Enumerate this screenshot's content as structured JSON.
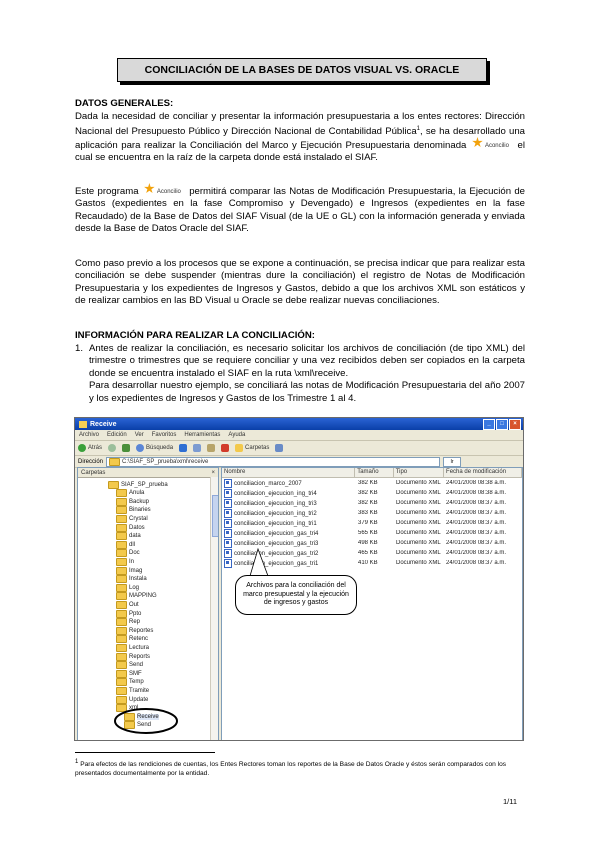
{
  "title": "CONCILIACIÓN DE LA BASES DE DATOS VISUAL VS. ORACLE",
  "section1": {
    "heading": "DATOS GENERALES:",
    "p1_a": "Dada la necesidad de conciliar y presentar la información presupuestaria a los entes rectores: Dirección Nacional del Presupuesto Público y Dirección Nacional de Contabilidad Pública",
    "p1_sup": "1",
    "p1_b": ", se ha desarrollado una aplicación para realizar la Conciliación del Marco y Ejecución Presupuestaria denominada",
    "p1_c": "el cual se encuentra en la raíz de la carpeta donde está instalado el SIAF.",
    "app_name": "Aconcilio",
    "p2_a": "Este programa",
    "p2_b": "permitirá comparar las Notas de Modificación Presupuestaria, la Ejecución de Gastos (expedientes en la fase Compromiso y Devengado) e Ingresos (expedientes en la fase Recaudado) de la Base de Datos del SIAF Visual (de la UE o GL) con la información generada y enviada desde la Base de Datos Oracle del SIAF.",
    "p3": "Como paso previo a los procesos que se expone a continuación, se precisa indicar que para realizar esta conciliación se debe suspender (mientras dure la conciliación) el registro de Notas de Modificación Presupuestaria y los expedientes de Ingresos y Gastos, debido a que los archivos XML son estáticos y de realizar cambios en las BD Visual u Oracle se debe realizar nuevas conciliaciones."
  },
  "section2": {
    "heading": "INFORMACIÓN PARA REALIZAR LA CONCILIACIÓN:",
    "item1_num": "1.",
    "item1_text": "Antes de realizar la conciliación, es necesario solicitar los archivos de conciliación (de tipo XML) del trimestre o trimestres que se requiere conciliar y una vez recibidos deben ser copiados en la carpeta donde se encuentra instalado el SIAF en la ruta \\xml\\receive.",
    "item1_text2": "Para desarrollar nuestro ejemplo, se conciliará las notas de Modificación Presupuestaria del año 2007 y los expedientes de Ingresos y Gastos de los Trimestre 1 al 4."
  },
  "screenshot": {
    "window_title": "Receive",
    "menu": [
      "Archivo",
      "Edición",
      "Ver",
      "Favoritos",
      "Herramientas",
      "Ayuda"
    ],
    "toolbar": {
      "back": "Atrás",
      "search": "Búsqueda",
      "folders": "Carpetas"
    },
    "address_label": "Dirección",
    "address": "C:\\SIAF_SP_prueba\\xml\\receive",
    "go": "Ir",
    "tree_header": "Carpetas",
    "tree_close": "×",
    "tree_items": [
      "SIAF_SP_prueba",
      "Anula",
      "Backup",
      "Binaries",
      "Crystal",
      "Datos",
      "data",
      "dll",
      "Doc",
      "In",
      "Imag",
      "Instala",
      "Log",
      "MAPPING",
      "Out",
      "Ppto",
      "Rep",
      "Reportes",
      "Retenc",
      "Lectura",
      "Reports",
      "Send",
      "SMF",
      "Temp",
      "Tramite",
      "Update",
      "xml",
      "Receive",
      "Send"
    ],
    "columns": [
      "Nombre",
      "Tamaño",
      "Tipo",
      "Fecha de modificación"
    ],
    "files": [
      {
        "name": "conciliacion_marco_2007",
        "size": "382 KB",
        "type": "Documento XML",
        "date": "24/01/2008 08:38 a.m."
      },
      {
        "name": "conciliacion_ejecucion_ing_tri4",
        "size": "382 KB",
        "type": "Documento XML",
        "date": "24/01/2008 08:38 a.m."
      },
      {
        "name": "conciliacion_ejecucion_ing_tri3",
        "size": "382 KB",
        "type": "Documento XML",
        "date": "24/01/2008 08:37 a.m."
      },
      {
        "name": "conciliacion_ejecucion_ing_tri2",
        "size": "383 KB",
        "type": "Documento XML",
        "date": "24/01/2008 08:37 a.m."
      },
      {
        "name": "conciliacion_ejecucion_ing_tri1",
        "size": "379 KB",
        "type": "Documento XML",
        "date": "24/01/2008 08:37 a.m."
      },
      {
        "name": "conciliacion_ejecucion_gas_tri4",
        "size": "565 KB",
        "type": "Documento XML",
        "date": "24/01/2008 08:37 a.m."
      },
      {
        "name": "conciliacion_ejecucion_gas_tri3",
        "size": "498 KB",
        "type": "Documento XML",
        "date": "24/01/2008 08:37 a.m."
      },
      {
        "name": "conciliacion_ejecucion_gas_tri2",
        "size": "465 KB",
        "type": "Documento XML",
        "date": "24/01/2008 08:37 a.m."
      },
      {
        "name": "conciliacion_ejecucion_gas_tri1",
        "size": "410 KB",
        "type": "Documento XML",
        "date": "24/01/2008 08:37 a.m."
      }
    ],
    "callout": "Archivos para la conciliación del marco presupuestal y la ejecución de ingresos y gastos"
  },
  "footnote": {
    "num": "1",
    "text": "Para efectos de las rendiciones de cuentas, los Entes Rectores toman los reportes de la Base de Datos Oracle y éstos serán comparados con los presentados documentalmente por la entidad."
  },
  "page_number": "1/11",
  "colors": {
    "title_bg": "#d9d9d9",
    "xp_blue": "#0a3fa8",
    "folder": "#f3c94b"
  }
}
